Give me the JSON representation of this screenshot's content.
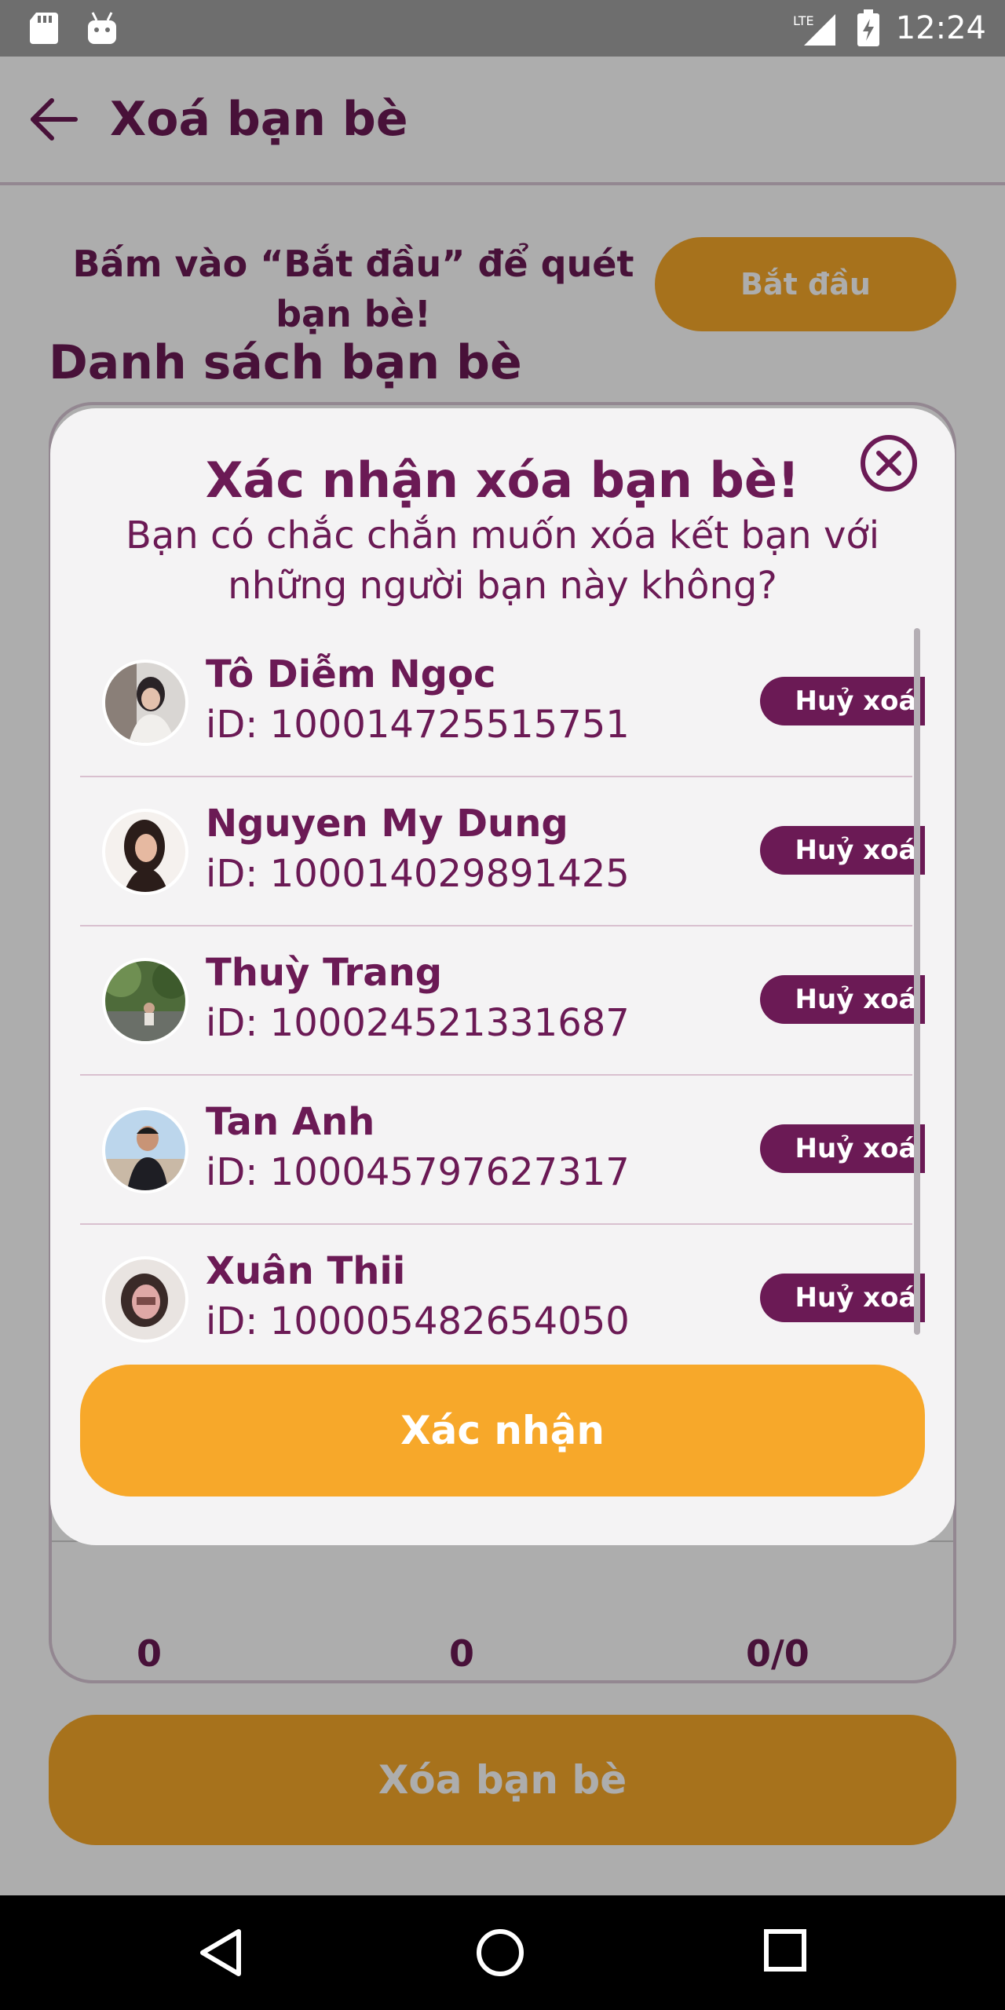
{
  "status_bar": {
    "time": "12:24",
    "network": "LTE",
    "icons": [
      "sd-card-icon",
      "android-icon",
      "lte-signal-icon",
      "battery-charging-icon"
    ]
  },
  "app_bar": {
    "title": "Xoá bạn bè",
    "back_icon": "arrow-left-icon"
  },
  "scan": {
    "instruction": "Bấm vào “Bắt đầu” để quét bạn bè!",
    "start_label": "Bắt đầu"
  },
  "list_heading": "Danh sách bạn bè",
  "stats": [
    "0",
    "0",
    "0/0"
  ],
  "delete_button_label": "Xóa bạn bè",
  "dialog": {
    "title": "Xác nhận xóa bạn bè!",
    "message": "Bạn có chắc chắn muốn xóa kết bạn với những người bạn này không?",
    "close_icon": "close-circle-icon",
    "friends": [
      {
        "name": "Tô Diễm Ngọc",
        "id": "iD: 100014725515751",
        "action": "Huỷ xoá"
      },
      {
        "name": "Nguyen My Dung",
        "id": "iD: 100014029891425",
        "action": "Huỷ xoá"
      },
      {
        "name": "Thuỳ Trang",
        "id": "iD: 100024521331687",
        "action": "Huỷ xoá"
      },
      {
        "name": "Tan Anh",
        "id": "iD: 100045797627317",
        "action": "Huỷ xoá"
      },
      {
        "name": "Xuân Thii",
        "id": "iD: 100005482654050",
        "action": "Huỷ xoá"
      }
    ],
    "confirm_label": "Xác nhận"
  },
  "colors": {
    "primary": "#6b1a55",
    "accent": "#f7a82a",
    "dialog_background": "#f4f3f4",
    "scrim": "rgba(0,0,0,0.32)"
  },
  "nav_bar": {
    "icons": [
      "nav-back-icon",
      "nav-home-icon",
      "nav-recents-icon"
    ]
  }
}
